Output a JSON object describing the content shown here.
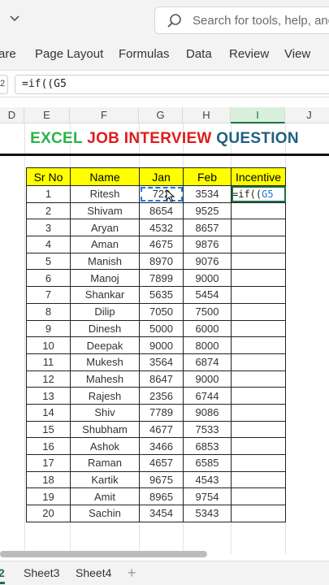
{
  "search": {
    "placeholder": "Search for tools, help, and"
  },
  "ribbon": {
    "items": [
      "are",
      "Page Layout",
      "Formulas",
      "Data",
      "Review",
      "View"
    ]
  },
  "formula_bar": {
    "name_box": "2",
    "content": "=if((G5"
  },
  "columns": [
    "D",
    "E",
    "F",
    "G",
    "H",
    "I",
    "J"
  ],
  "active_column": "I",
  "title": {
    "part1": "EXCEL",
    "part2": "JOB INTERVIEW",
    "part3": "QUESTION",
    "colors": {
      "part1": "#2bb34a",
      "part2": "#e01b1b",
      "part3": "#1f5f80"
    }
  },
  "table": {
    "headers": [
      "Sr No",
      "Name",
      "Jan",
      "Feb",
      "Incentive"
    ],
    "header_color": "#ffff00",
    "rows": [
      [
        "1",
        "Ritesh",
        "722",
        "3534"
      ],
      [
        "2",
        "Shivam",
        "8654",
        "9525"
      ],
      [
        "3",
        "Aryan",
        "4532",
        "8657"
      ],
      [
        "4",
        "Aman",
        "4675",
        "9876"
      ],
      [
        "5",
        "Manish",
        "8970",
        "9076"
      ],
      [
        "6",
        "Manoj",
        "7899",
        "9000"
      ],
      [
        "7",
        "Shankar",
        "5635",
        "5454"
      ],
      [
        "8",
        "Dilip",
        "7050",
        "7500"
      ],
      [
        "9",
        "Dinesh",
        "5000",
        "6000"
      ],
      [
        "10",
        "Deepak",
        "9000",
        "8000"
      ],
      [
        "11",
        "Mukesh",
        "3564",
        "6874"
      ],
      [
        "12",
        "Mahesh",
        "8647",
        "9000"
      ],
      [
        "13",
        "Rajesh",
        "2356",
        "6744"
      ],
      [
        "14",
        "Shiv",
        "7789",
        "9086"
      ],
      [
        "15",
        "Shubham",
        "4677",
        "7533"
      ],
      [
        "16",
        "Ashok",
        "3466",
        "6853"
      ],
      [
        "17",
        "Raman",
        "4657",
        "6585"
      ],
      [
        "18",
        "Kartik",
        "9675",
        "4543"
      ],
      [
        "19",
        "Amit",
        "8965",
        "9754"
      ],
      [
        "20",
        "Sachin",
        "3454",
        "5343"
      ]
    ],
    "editing_cell": {
      "prefix": "=if((",
      "ref": "G5"
    }
  },
  "sheet_tabs": {
    "active": "2",
    "others": [
      "Sheet3",
      "Sheet4"
    ],
    "add": "+"
  }
}
